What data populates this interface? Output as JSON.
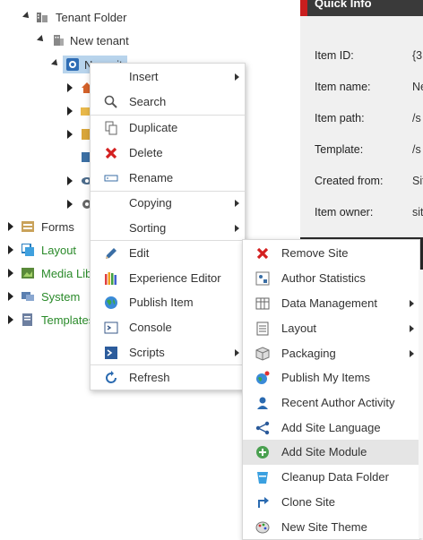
{
  "tree": {
    "tenant_folder": "Tenant Folder",
    "new_tenant": "New tenant",
    "new_site": "New site",
    "forms": "Forms",
    "layout": "Layout",
    "media_library": "Media Libr",
    "system": "System",
    "templates": "Templates"
  },
  "quick_info": {
    "title": "Quick Info",
    "rows": [
      {
        "label": "Item ID:",
        "value": "{3"
      },
      {
        "label": "Item name:",
        "value": "Ne"
      },
      {
        "label": "Item path:",
        "value": "/s"
      },
      {
        "label": "Template:",
        "value": "/s"
      },
      {
        "label": "Created from:",
        "value": "Sit"
      },
      {
        "label": "Item owner:",
        "value": "sit"
      }
    ]
  },
  "context_menu": {
    "items": [
      {
        "label": "Insert",
        "icon": "insert-icon"
      },
      {
        "label": "Search",
        "icon": "search-icon"
      },
      {
        "label": "Duplicate",
        "icon": "duplicate-icon"
      },
      {
        "label": "Delete",
        "icon": "delete-icon"
      },
      {
        "label": "Rename",
        "icon": "rename-icon"
      },
      {
        "label": "Copying",
        "icon": "copying-icon"
      },
      {
        "label": "Sorting",
        "icon": "sorting-icon"
      },
      {
        "label": "Edit",
        "icon": "pencil-icon"
      },
      {
        "label": "Experience Editor",
        "icon": "experience-editor-icon"
      },
      {
        "label": "Publish Item",
        "icon": "globe-icon"
      },
      {
        "label": "Console",
        "icon": "console-icon"
      },
      {
        "label": "Scripts",
        "icon": "scripts-icon"
      },
      {
        "label": "Refresh",
        "icon": "refresh-icon"
      }
    ]
  },
  "scripts_menu": {
    "items": [
      {
        "label": "Remove Site",
        "icon": "remove-icon"
      },
      {
        "label": "Author Statistics",
        "icon": "statistics-icon"
      },
      {
        "label": "Data Management",
        "icon": "data-management-icon"
      },
      {
        "label": "Layout",
        "icon": "layout-icon"
      },
      {
        "label": "Packaging",
        "icon": "package-icon"
      },
      {
        "label": "Publish My Items",
        "icon": "publish-globe-icon"
      },
      {
        "label": "Recent Author Activity",
        "icon": "user-icon"
      },
      {
        "label": "Add Site Language",
        "icon": "share-icon"
      },
      {
        "label": "Add Site Module",
        "icon": "add-circle-icon"
      },
      {
        "label": "Cleanup Data Folder",
        "icon": "cleanup-icon"
      },
      {
        "label": "Clone Site",
        "icon": "clone-icon"
      },
      {
        "label": "New Site Theme",
        "icon": "palette-icon"
      }
    ]
  }
}
